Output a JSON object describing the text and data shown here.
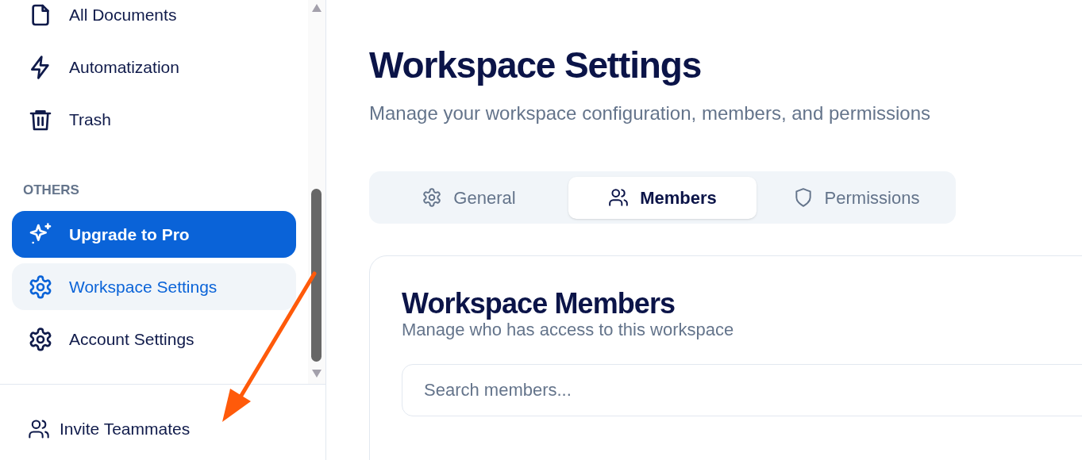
{
  "sidebar": {
    "items": [
      {
        "kind": "nav",
        "label": "All Documents",
        "selected": false
      },
      {
        "kind": "nav",
        "label": "Automatization",
        "selected": false
      },
      {
        "kind": "nav",
        "label": "Trash",
        "selected": false
      },
      {
        "kind": "heading",
        "label": "OTHERS"
      },
      {
        "kind": "promo",
        "label": "Upgrade to Pro",
        "selected": false
      },
      {
        "kind": "nav",
        "label": "Workspace Settings",
        "selected": true
      },
      {
        "kind": "nav",
        "label": "Account Settings",
        "selected": false
      }
    ],
    "footer": {
      "label": "Invite Teammates"
    }
  },
  "page": {
    "title": "Workspace Settings",
    "subtitle": "Manage your workspace configuration, members, and permissions"
  },
  "tabs": [
    {
      "label": "General",
      "selected": false
    },
    {
      "label": "Members",
      "selected": true
    },
    {
      "label": "Permissions",
      "selected": false
    }
  ],
  "card": {
    "title": "Workspace Members",
    "subtitle": "Manage who has access to this workspace",
    "search": {
      "placeholder": "Search members..."
    }
  }
}
